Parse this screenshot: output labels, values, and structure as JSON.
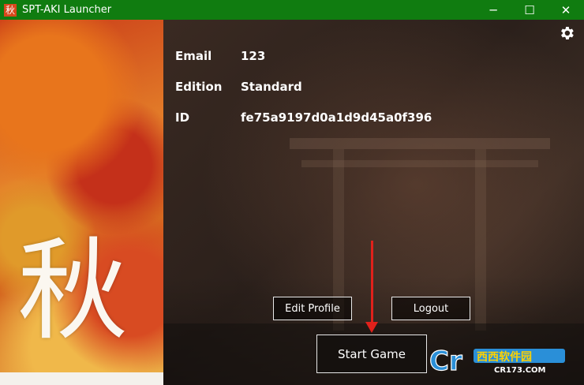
{
  "window": {
    "title": "SPT-AKI Launcher",
    "icon_char": "秋",
    "minimize": "─",
    "maximize": "☐",
    "close": "✕"
  },
  "art": {
    "kanji": "秋"
  },
  "profile": {
    "rows": [
      {
        "label": "Email",
        "value": "123"
      },
      {
        "label": "Edition",
        "value": "Standard"
      },
      {
        "label": "ID",
        "value": "fe75a9197d0a1d9d45a0f396"
      }
    ]
  },
  "actions": {
    "edit_profile": "Edit Profile",
    "logout": "Logout",
    "start_game": "Start Game"
  },
  "watermark": {
    "brand": "西西软件园",
    "url": "CR173.COM"
  },
  "colors": {
    "titlebar": "#107c10",
    "arrow": "#e0211b"
  }
}
